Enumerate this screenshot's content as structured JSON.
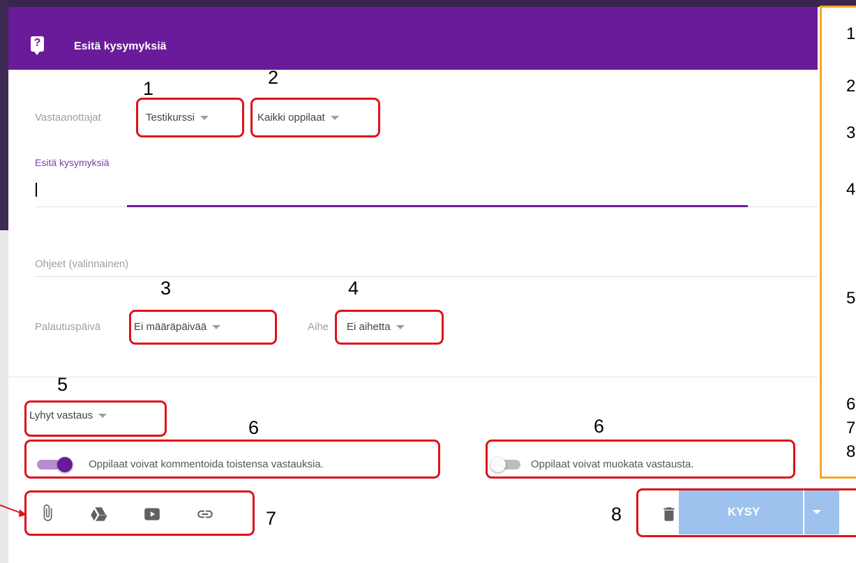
{
  "header": {
    "title": "Esitä kysymyksiä"
  },
  "recipients": {
    "label": "Vastaanottajat",
    "course": "Testikurssi",
    "students": "Kaikki oppilaat"
  },
  "question": {
    "label": "Esitä kysymyksiä",
    "value": ""
  },
  "instructions": {
    "placeholder": "Ohjeet (valinnainen)"
  },
  "due": {
    "label": "Palautuspäivä",
    "value": "Ei määräpäivää"
  },
  "topic": {
    "label": "Aihe",
    "value": "Ei aihetta"
  },
  "answer_type": {
    "value": "Lyhyt vastaus"
  },
  "toggles": {
    "comment": {
      "label": "Oppilaat voivat kommentoida toistensa vastauksia.",
      "on": true
    },
    "edit": {
      "label": "Oppilaat voivat muokata vastausta.",
      "on": false
    }
  },
  "attach_icons": [
    "paperclip-icon",
    "google-drive-icon",
    "youtube-icon",
    "link-icon"
  ],
  "actions": {
    "ask_label": "KYSY"
  },
  "annotations": {
    "n1": "1",
    "n2": "2",
    "n3": "3",
    "n4": "4",
    "n5": "5",
    "n6a": "6",
    "n6b": "6",
    "n7": "7",
    "n8": "8"
  },
  "side_numbers": [
    "1",
    "2",
    "3",
    "4",
    "5",
    "6",
    "7",
    "8"
  ],
  "colors": {
    "header": "#6a1b9a",
    "accent": "#6a1b9a",
    "annotation": "#e0101a",
    "side_box": "#f5a623",
    "ask_button": "#9ec2ee"
  }
}
